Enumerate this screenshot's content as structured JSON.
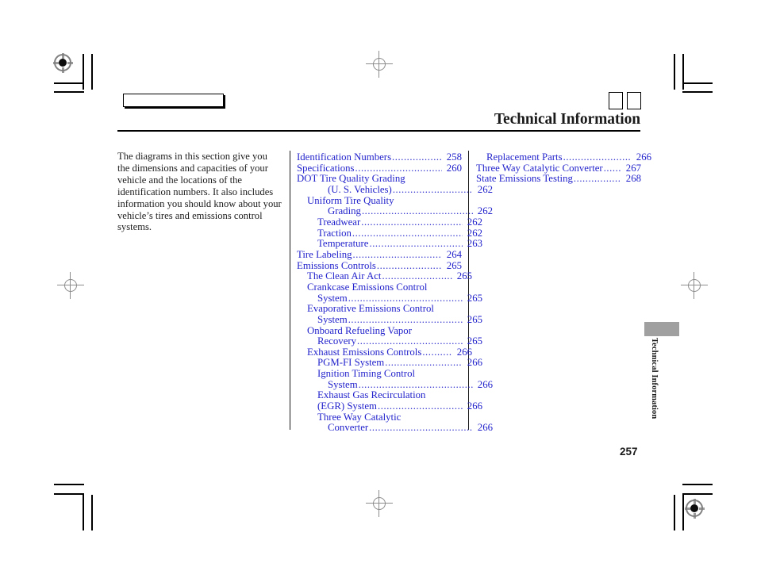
{
  "document": {
    "header_title": "Technical Information",
    "folio": "257",
    "side_tab_label": "Technical Information"
  },
  "intro": {
    "text": "The diagrams in this section give you the dimensions and capacities of your vehicle and the locations of the identification numbers. It also includes information you should know about your vehicle’s tires and emissions control systems."
  },
  "toc": {
    "middle_column": [
      {
        "label": "Identification Numbers",
        "page": "258",
        "indent": 0,
        "dots": true
      },
      {
        "label": "Specifications ",
        "page": "260",
        "indent": 0,
        "dots": true
      },
      {
        "label": "DOT Tire Quality Grading",
        "page": "",
        "indent": 0,
        "dots": false
      },
      {
        "label": "(U. S. Vehicles) ",
        "page": "262",
        "indent": 3,
        "dots": true
      },
      {
        "label": "Uniform Tire Quality",
        "page": "",
        "indent": 1,
        "dots": false
      },
      {
        "label": "Grading",
        "page": "262",
        "indent": 3,
        "dots": true
      },
      {
        "label": "Treadwear ",
        "page": "262",
        "indent": 2,
        "dots": true
      },
      {
        "label": "Traction",
        "page": "262",
        "indent": 2,
        "dots": true
      },
      {
        "label": "Temperature ",
        "page": "263",
        "indent": 2,
        "dots": true
      },
      {
        "label": "Tire Labeling",
        "page": "264",
        "indent": 0,
        "dots": true
      },
      {
        "label": "Emissions Controls",
        "page": "265",
        "indent": 0,
        "dots": true
      },
      {
        "label": "The Clean Air Act",
        "page": "265",
        "indent": 1,
        "dots": true
      },
      {
        "label": "Crankcase Emissions Control",
        "page": "",
        "indent": 1,
        "dots": false
      },
      {
        "label": "System",
        "page": "265",
        "indent": 2,
        "dots": true
      },
      {
        "label": "Evaporative Emissions Control",
        "page": "",
        "indent": 1,
        "dots": false
      },
      {
        "label": "System",
        "page": "265",
        "indent": 2,
        "dots": true
      },
      {
        "label": "Onboard Refueling Vapor",
        "page": "",
        "indent": 1,
        "dots": false
      },
      {
        "label": "Recovery ",
        "page": "265",
        "indent": 2,
        "dots": true
      },
      {
        "label": "Exhaust Emissions Controls ",
        "page": "266",
        "indent": 1,
        "dots": true
      },
      {
        "label": "PGM-FI System ",
        "page": "266",
        "indent": 2,
        "dots": true
      },
      {
        "label": "Ignition Timing Control",
        "page": "",
        "indent": 2,
        "dots": false
      },
      {
        "label": "System",
        "page": "266",
        "indent": 3,
        "dots": true
      },
      {
        "label": "Exhaust Gas Recirculation",
        "page": "",
        "indent": 2,
        "dots": false
      },
      {
        "label": "(EGR) System",
        "page": "266",
        "indent": 2,
        "dots": true
      },
      {
        "label": "Three Way Catalytic",
        "page": "",
        "indent": 2,
        "dots": false
      },
      {
        "label": "Converter",
        "page": "266",
        "indent": 3,
        "dots": true
      }
    ],
    "right_column": [
      {
        "label": "Replacement Parts",
        "page": "266",
        "indent": 1,
        "dots": true
      },
      {
        "label": "Three Way Catalytic Converter",
        "page": "267",
        "indent": 0,
        "dots": true
      },
      {
        "label": "State Emissions Testing ",
        "page": "268",
        "indent": 0,
        "dots": true
      }
    ],
    "leader_char": "."
  },
  "colors": {
    "toc_link": "#2222cc",
    "body_text": "#1c1c1c",
    "tab_gray": "#a0a0a0",
    "rule": "#000000"
  }
}
